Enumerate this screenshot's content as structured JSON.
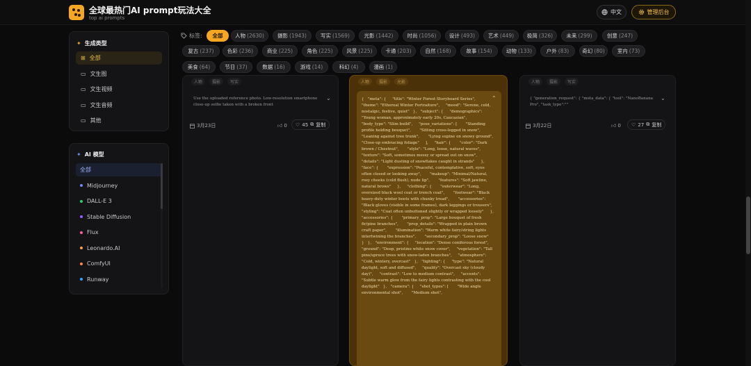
{
  "header": {
    "title": "全球最热门AI prompt玩法大全",
    "subtitle": "top ai prompts",
    "lang_label": "中文",
    "admin_label": "管理后台"
  },
  "sidebar": {
    "gen_title": "生成类型",
    "gen_items": [
      {
        "label": "全部",
        "icon": "grid-icon"
      },
      {
        "label": "文生图",
        "icon": "folder-icon"
      },
      {
        "label": "文生视频",
        "icon": "folder-icon"
      },
      {
        "label": "文生音频",
        "icon": "folder-icon"
      },
      {
        "label": "其他",
        "icon": "folder-icon"
      }
    ],
    "model_title": "AI 模型",
    "model_items": [
      {
        "label": "全部",
        "color": ""
      },
      {
        "label": "Midjourney",
        "color": "#6b8cff"
      },
      {
        "label": "DALL-E 3",
        "color": "#2ecc71"
      },
      {
        "label": "Stable Diffusion",
        "color": "#9b59ff"
      },
      {
        "label": "Flux",
        "color": "#ff5fa2"
      },
      {
        "label": "Leonardo.AI",
        "color": "#ff9f43"
      },
      {
        "label": "ComfyUI",
        "color": "#ff8a3d"
      },
      {
        "label": "Runway",
        "color": "#3aa0ff"
      }
    ]
  },
  "tags": {
    "label": "标签:",
    "items": [
      {
        "name": "全部",
        "count": ""
      },
      {
        "name": "人物",
        "count": "(2630)"
      },
      {
        "name": "摄影",
        "count": "(1943)"
      },
      {
        "name": "写实",
        "count": "(1569)"
      },
      {
        "name": "光影",
        "count": "(1442)"
      },
      {
        "name": "时尚",
        "count": "(1056)"
      },
      {
        "name": "设计",
        "count": "(493)"
      },
      {
        "name": "艺术",
        "count": "(449)"
      },
      {
        "name": "极简",
        "count": "(326)"
      },
      {
        "name": "未来",
        "count": "(299)"
      },
      {
        "name": "创意",
        "count": "(247)"
      },
      {
        "name": "复古",
        "count": "(237)"
      },
      {
        "name": "色彩",
        "count": "(236)"
      },
      {
        "name": "商业",
        "count": "(225)"
      },
      {
        "name": "角色",
        "count": "(225)"
      },
      {
        "name": "风景",
        "count": "(225)"
      },
      {
        "name": "卡通",
        "count": "(203)"
      },
      {
        "name": "自然",
        "count": "(168)"
      },
      {
        "name": "故事",
        "count": "(154)"
      },
      {
        "name": "动物",
        "count": "(133)"
      },
      {
        "name": "户外",
        "count": "(83)"
      },
      {
        "name": "奇幻",
        "count": "(80)"
      },
      {
        "name": "室内",
        "count": "(73)"
      },
      {
        "name": "美食",
        "count": "(64)"
      },
      {
        "name": "节日",
        "count": "(37)"
      },
      {
        "name": "数据",
        "count": "(16)"
      },
      {
        "name": "游戏",
        "count": "(14)"
      },
      {
        "name": "科幻",
        "count": "(4)"
      },
      {
        "name": "漫画",
        "count": "(1)"
      }
    ]
  },
  "cards": [
    {
      "mini_tags": [
        "人物",
        "摄影",
        "写实"
      ],
      "text": "Use the uploaded reference photo. Low-resolution smartphone close-up selfie taken with a broken front",
      "date": "3月23日",
      "likes": "0",
      "favorites": "45",
      "copy_label": "复制"
    },
    {
      "mini_tags": [
        "人物",
        "摄影",
        "光影"
      ],
      "text": "{   \"meta\": {     \"title\": \"Winter Forest Storyboard Series\",     \"theme\": \"Ethereal Winter Fortraiture\",     \"mood\": \"Serene, cold, nostalgic, festive, quiet\"   },   \"subject\": {     \"demographics\": \"Young woman, approximately early 20s, Caucasian\",     \"body_type\": \"Slim build\",     \"pose_variations\": [       \"Standing profile holding bouquet\",       \"Sitting cross-legged in snow\",       \"Leaning against tree trunk\",       \"Lying supine on snowy ground\",       \"Close-up embracing foliage\"     ],     \"hair\": {       \"color\": \"Dark brown / Chestnut\",       \"style\": \"Long, loose, natural waves\",       \"texture\": \"Soft, sometimes messy or spread out on snow\",       \"details\": \"Light dusting of snowflakes caught in strands\"     },     \"face\": {       \"expression\": \"Peaceful, contemplative, soft, eyes often closed or looking away\",       \"makeup\": \"Minimal/Natural, rosy cheeks (cold flush), nude lip\",       \"features\": \"Soft jawline, natural brows\"     },     \"clothing\": {       \"outerwear\": \"Long, oversized black wool coat or trench coat\",       \"footwear\": \"Black heavy-duty winter boots with chunky tread\",       \"accessories\": \"Black gloves (visible in some frames), dark leggings or trousers\",       \"styling\": \"Coat often unbuttoned slightly or wrapped loosely\"     },     \"accessories\": {       \"primary_prop\": \"Large bouquet of fresh fir/pine branches\",       \"prop_details\": \"Wrapped in plain brown craft paper\",       \"illumination\": \"Warm white fairy/string lights intertwining the branches\",       \"secondary_prop\": \"Loose snow\"     }   },   \"environment\": {     \"location\": \"Dense coniferous forest\",     \"ground\": \"Deep, pristine white snow cover\",     \"vegetation\": \"Tall pine/spruce trees with snow-laden branches\",     \"atmosphere\": \"Cold, wintery, overcast\"   },   \"lighting\": {     \"type\": \"Natural daylight, soft and diffused\",     \"quality\": \"Overcast sky (cloudy day)\",     \"contrast\": \"Low to medium contrast\",     \"accents\": \"Subtle warm glow from the fairy lights contrasting with the cool daylight\"   },   \"camera\": {     \"shot_types\": [       \"Wide angle environmental shot\",       \"Medium shot\","
    },
    {
      "mini_tags": [
        "人物",
        "摄影",
        "写实"
      ],
      "text": "{ \"generation_request\": { \"meta_data\": { \"tool\": \"NanoBanana Pro\", \"task_type\":\"\"",
      "date": "3月22日",
      "likes": "0",
      "favorites": "27",
      "copy_label": "复制"
    }
  ]
}
